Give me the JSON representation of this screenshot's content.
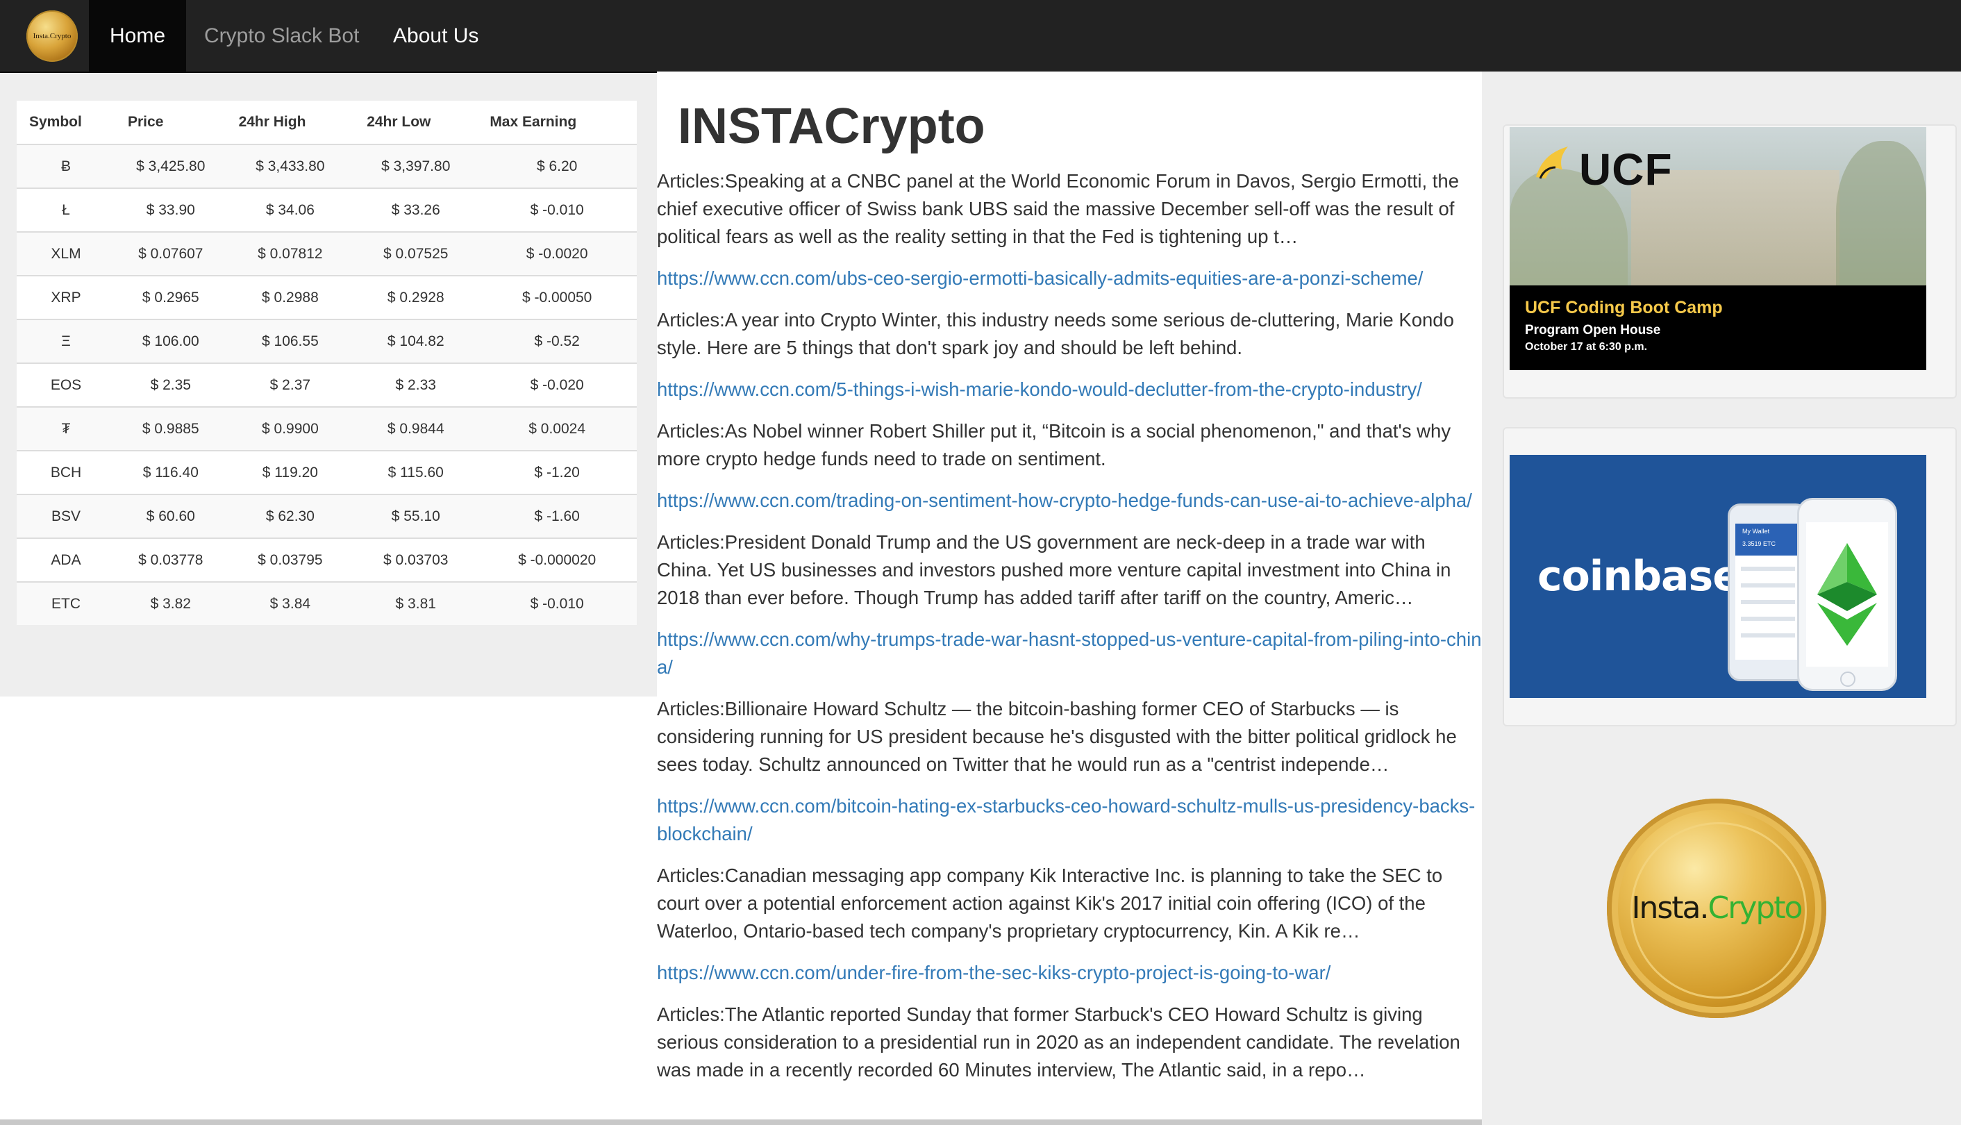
{
  "navbar": {
    "logo_text": "Insta.Crypto",
    "items": [
      {
        "label": "Home",
        "active": true
      },
      {
        "label": "Crypto Slack Bot",
        "active": false
      },
      {
        "label": "About Us",
        "active": false
      }
    ]
  },
  "table": {
    "headers": [
      "Symbol",
      "Price",
      "24hr High",
      "24hr Low",
      "Max Earning"
    ],
    "rows": [
      [
        "Ƀ",
        "$ 3,425.80",
        "$ 3,433.80",
        "$ 3,397.80",
        "$ 6.20"
      ],
      [
        "Ł",
        "$ 33.90",
        "$ 34.06",
        "$ 33.26",
        "$ -0.010"
      ],
      [
        "XLM",
        "$ 0.07607",
        "$ 0.07812",
        "$ 0.07525",
        "$ -0.0020"
      ],
      [
        "XRP",
        "$ 0.2965",
        "$ 0.2988",
        "$ 0.2928",
        "$ -0.00050"
      ],
      [
        "Ξ",
        "$ 106.00",
        "$ 106.55",
        "$ 104.82",
        "$ -0.52"
      ],
      [
        "EOS",
        "$ 2.35",
        "$ 2.37",
        "$ 2.33",
        "$ -0.020"
      ],
      [
        "₮",
        "$ 0.9885",
        "$ 0.9900",
        "$ 0.9844",
        "$ 0.0024"
      ],
      [
        "BCH",
        "$ 116.40",
        "$ 119.20",
        "$ 115.60",
        "$ -1.20"
      ],
      [
        "BSV",
        "$ 60.60",
        "$ 62.30",
        "$ 55.10",
        "$ -1.60"
      ],
      [
        "ADA",
        "$ 0.03778",
        "$ 0.03795",
        "$ 0.03703",
        "$ -0.000020"
      ],
      [
        "ETC",
        "$ 3.82",
        "$ 3.84",
        "$ 3.81",
        "$ -0.010"
      ]
    ]
  },
  "main": {
    "title": "INSTACrypto",
    "articles": [
      {
        "text": "Articles:Speaking at a CNBC panel at the World Economic Forum in Davos, Sergio Ermotti, the chief executive officer of Swiss bank UBS said the massive December sell-off was the result of political fears as well as the reality setting in that the Fed is tightening up t…",
        "link": "https://www.ccn.com/ubs-ceo-sergio-ermotti-basically-admits-equities-are-a-ponzi-scheme/"
      },
      {
        "text": "Articles:A year into Crypto Winter, this industry needs some serious de-cluttering, Marie Kondo style. Here are 5 things that don't spark joy and should be left behind.",
        "link": "https://www.ccn.com/5-things-i-wish-marie-kondo-would-declutter-from-the-crypto-industry/"
      },
      {
        "text": "Articles:As Nobel winner Robert Shiller put it, “Bitcoin is a social phenomenon,\" and that's why more crypto hedge funds need to trade on sentiment.",
        "link": "https://www.ccn.com/trading-on-sentiment-how-crypto-hedge-funds-can-use-ai-to-achieve-alpha/"
      },
      {
        "text": "Articles:President Donald Trump and the US government are neck-deep in a trade war with China. Yet US businesses and investors pushed more venture capital investment into China in 2018 than ever before. Though Trump has added tariff after tariff on the country, Americ…",
        "link": "https://www.ccn.com/why-trumps-trade-war-hasnt-stopped-us-venture-capital-from-piling-into-china/"
      },
      {
        "text": "Articles:Billionaire Howard Schultz — the bitcoin-bashing former CEO of Starbucks — is considering running for US president because he's disgusted with the bitter political gridlock he sees today. Schultz announced on Twitter that he would run as a \"centrist independe…",
        "link": "https://www.ccn.com/bitcoin-hating-ex-starbucks-ceo-howard-schultz-mulls-us-presidency-backs-blockchain/"
      },
      {
        "text": "Articles:Canadian messaging app company Kik Interactive Inc. is planning to take the SEC to court over a potential enforcement action against Kik's 2017 initial coin offering (ICO) of the Waterloo, Ontario-based tech company's proprietary cryptocurrency, Kin. A Kik re…",
        "link": "https://www.ccn.com/under-fire-from-the-sec-kiks-crypto-project-is-going-to-war/"
      },
      {
        "text": "Articles:The Atlantic reported Sunday that former Starbuck's CEO Howard Schultz is giving serious consideration to a presidential run in 2020 as an independent candidate. The revelation was made in a recently recorded 60 Minutes interview, The Atlantic said, in a repo…",
        "link": ""
      }
    ]
  },
  "sidebar": {
    "ucf_ad": {
      "logo": "UCF",
      "heading": "UCF Coding Boot Camp",
      "line1": "Program Open House",
      "line2": "October 17 at 6:30 p.m."
    },
    "coinbase_ad": {
      "wordmark": "coinbase",
      "phone_label": "My Wallet",
      "phone_balance": "3.3519 ETC"
    },
    "coin_logo": {
      "part1": "Insta.",
      "part2": "Crypto"
    }
  },
  "colors": {
    "navbar_bg": "#222222",
    "link": "#337ab7",
    "coinbase_blue": "#1f5499",
    "ucf_gold": "#f6c94a",
    "insta_green": "#34b233"
  }
}
